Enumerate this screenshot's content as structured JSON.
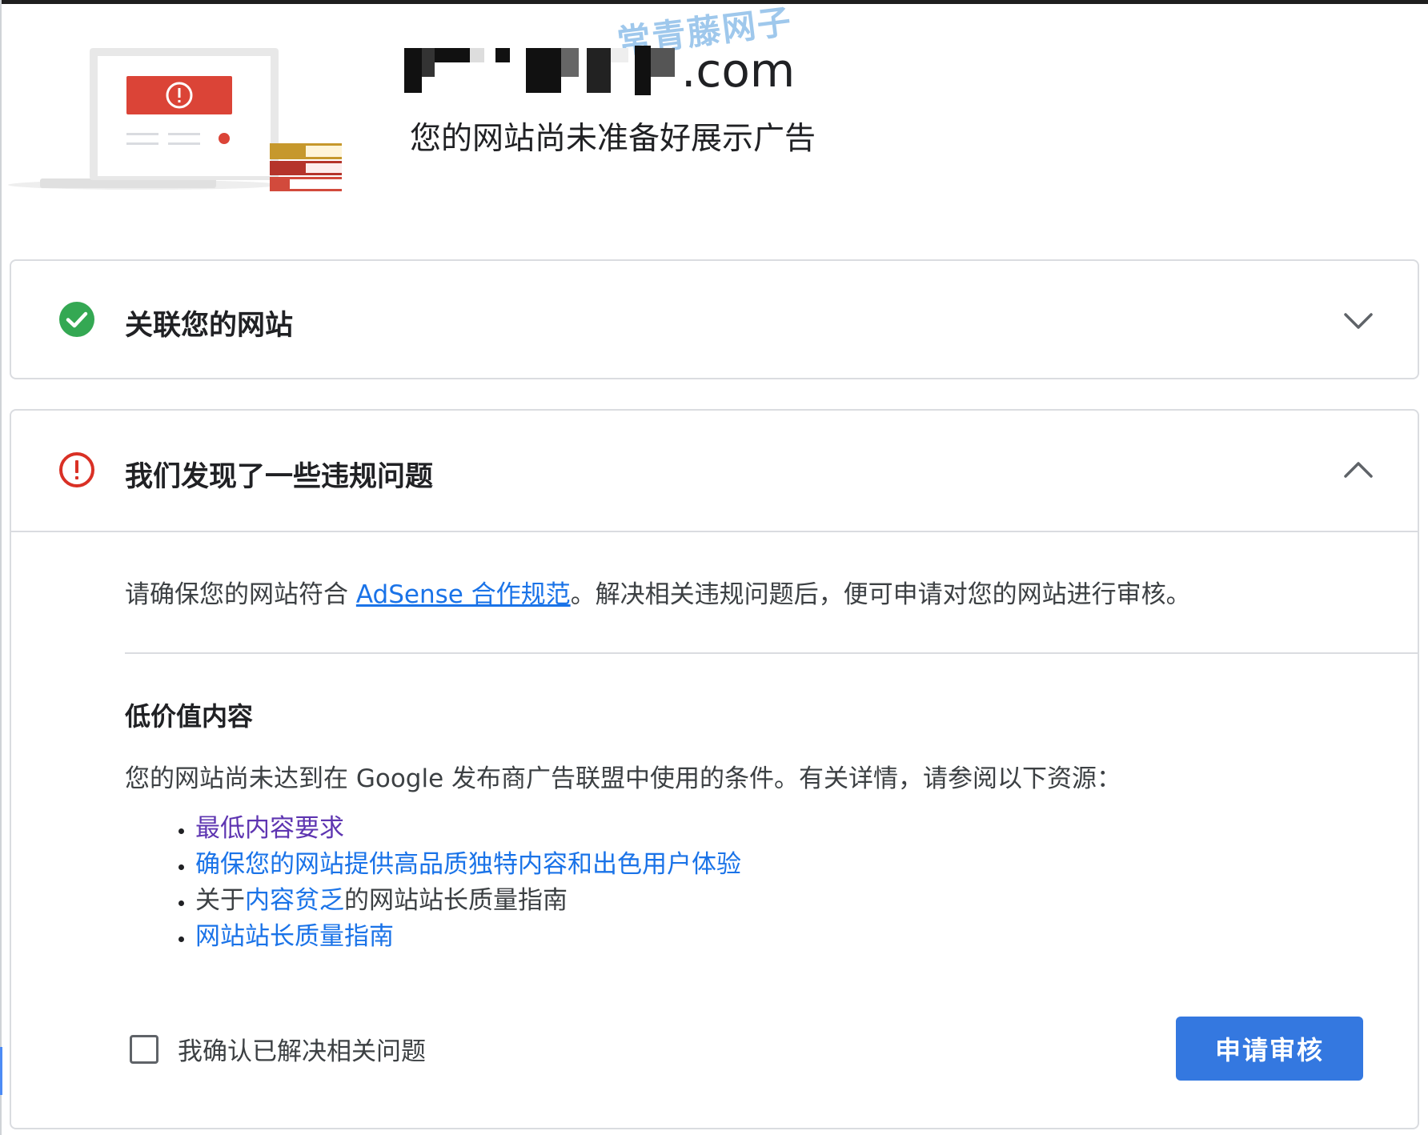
{
  "watermark": "常青藤网子",
  "site": {
    "domain_suffix": ".com",
    "status_title": "您的网站尚未准备好展示广告"
  },
  "steps": [
    {
      "title": "关联您的网站",
      "status": "complete",
      "status_icon": "check-circle-icon",
      "status_color": "#34a853",
      "expanded": false
    },
    {
      "title": "我们发现了一些违规问题",
      "status": "error",
      "status_icon": "error-circle-icon",
      "status_color": "#d93025",
      "expanded": true
    }
  ],
  "violation": {
    "intro_before": "请确保您的网站符合 ",
    "intro_link": "AdSense 合作规范",
    "intro_after": "。解决相关违规问题后，便可申请对您的网站进行审核。",
    "section_title": "低价值内容",
    "section_desc": "您的网站尚未达到在 Google 发布商广告联盟中使用的条件。有关详情，请参阅以下资源：",
    "resources": [
      {
        "link": "最低内容要求"
      },
      {
        "link": "确保您的网站提供高品质独特内容和出色用户体验"
      },
      {
        "prefix": "关于",
        "link": "内容贫乏",
        "suffix": "的网站站长质量指南"
      },
      {
        "link": "网站站长质量指南"
      }
    ],
    "confirm_label": "我确认已解决相关问题",
    "confirm_checked": false,
    "submit_label": "申请审核"
  },
  "colors": {
    "accent": "#1a73e8",
    "button": "#3478e0",
    "success": "#34a853",
    "error": "#d93025",
    "visited_link": "#5e35b1"
  }
}
